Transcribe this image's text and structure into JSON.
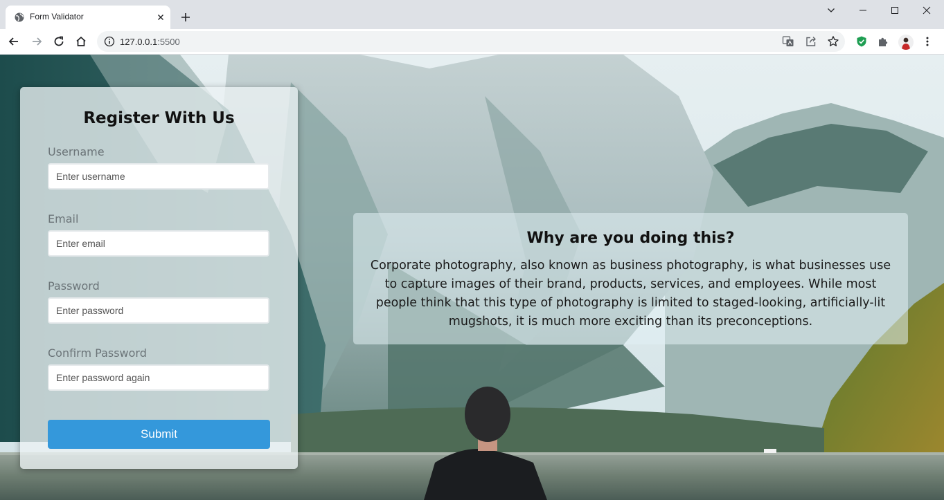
{
  "browser": {
    "tab_title": "Form Validator",
    "url_host": "127.0.0.1",
    "url_port": ":5500"
  },
  "form": {
    "title": "Register With Us",
    "fields": [
      {
        "label": "Username",
        "placeholder": "Enter username",
        "value": ""
      },
      {
        "label": "Email",
        "placeholder": "Enter email",
        "value": ""
      },
      {
        "label": "Password",
        "placeholder": "Enter password",
        "value": ""
      },
      {
        "label": "Confirm Password",
        "placeholder": "Enter password again",
        "value": ""
      }
    ],
    "submit_label": "Submit"
  },
  "info": {
    "title": "Why are you doing this?",
    "body": "Corporate photography, also known as business photography, is what businesses use to capture images of their brand, products, services, and employees. While most people think that this type of photography is limited to staged-looking, artificially-lit mugshots, it is much more exciting than its preconceptions."
  },
  "colors": {
    "accent": "#3498db",
    "chrome_bg": "#dee1e6",
    "sky": "#dbe8ec",
    "lake": "#7a8a7c"
  },
  "icons": [
    "globe-icon",
    "close-icon",
    "plus-icon",
    "chevron-down-icon",
    "minimize-icon",
    "maximize-icon",
    "back-icon",
    "forward-icon",
    "reload-icon",
    "home-icon",
    "info-icon",
    "translate-icon",
    "share-icon",
    "star-icon",
    "shield-icon",
    "puzzle-icon",
    "more-icon"
  ]
}
